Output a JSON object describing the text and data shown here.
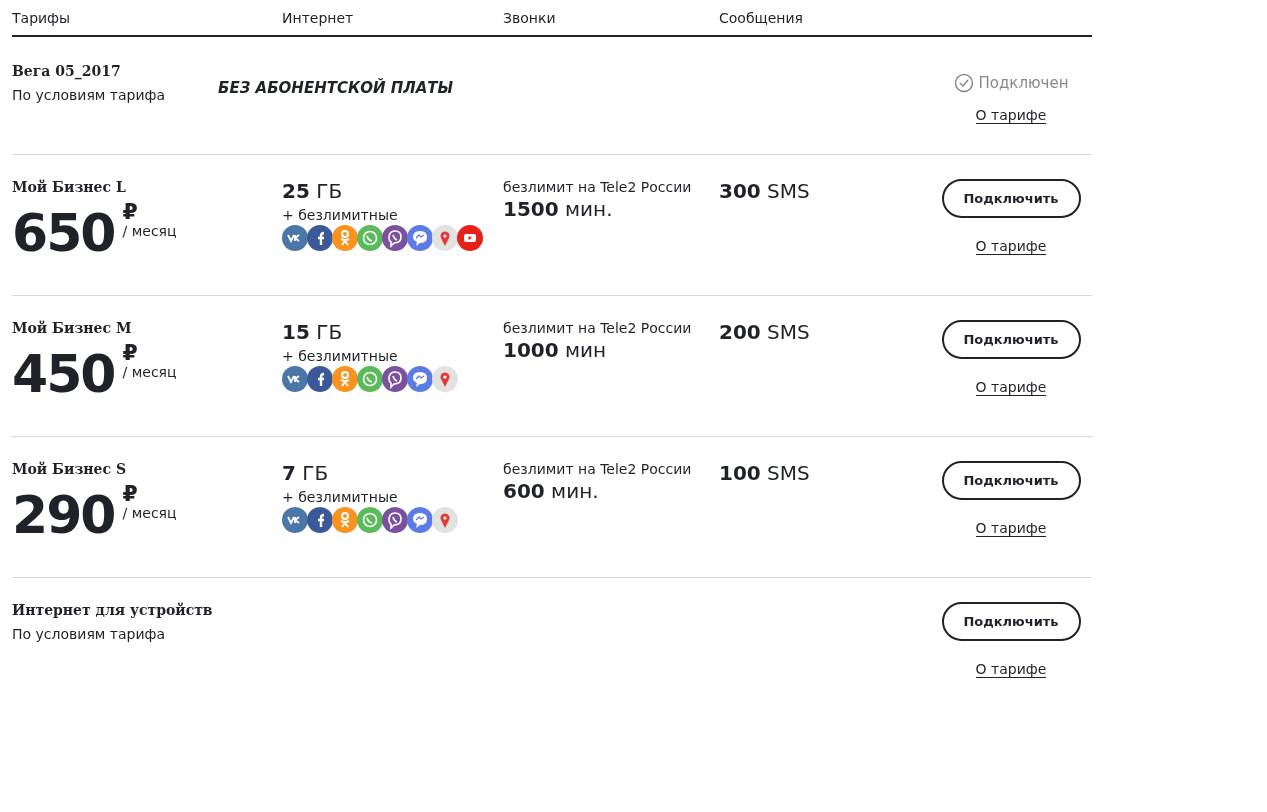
{
  "header": {
    "columns": [
      "Тарифы",
      "Интернет",
      "Звонки",
      "Сообщения"
    ]
  },
  "tariffs": [
    {
      "kind": "special",
      "name": "Вега 05_2017",
      "subtitle": "По условиям тарифа",
      "note": "БЕЗ АБОНЕНТСКОЙ ПЛАТЫ",
      "connected": true,
      "status": "Подключен",
      "link": "О тарифе"
    },
    {
      "kind": "plan",
      "name": "Мой Бизнес L",
      "price": "650",
      "currency": "₽",
      "period": "/ месяц",
      "data_amount": "25",
      "data_unit": "ГБ",
      "unlimited_label": "+ безлимитные",
      "apps": [
        {
          "kind": "vk",
          "color": "#4a76a8"
        },
        {
          "kind": "facebook",
          "color": "#3b5998"
        },
        {
          "kind": "ok",
          "color": "#f7931e"
        },
        {
          "kind": "whatsapp",
          "color": "#5bba5b"
        },
        {
          "kind": "viber",
          "color": "#7b519d"
        },
        {
          "kind": "messenger",
          "color": "#5b7be6"
        },
        {
          "kind": "maps",
          "color": "#e2e2e2"
        },
        {
          "kind": "youtube",
          "color": "#e62117"
        }
      ],
      "calls_label": "безлимит на Tele2 России",
      "minutes_amount": "1500",
      "minutes_unit": "мин.",
      "sms_amount": "300",
      "sms_unit": "SMS",
      "connected": false,
      "button": "Подключить",
      "link": "О тарифе"
    },
    {
      "kind": "plan",
      "name": "Мой Бизнес M",
      "price": "450",
      "currency": "₽",
      "period": "/ месяц",
      "data_amount": "15",
      "data_unit": "ГБ",
      "unlimited_label": "+ безлимитные",
      "apps": [
        {
          "kind": "vk",
          "color": "#4a76a8"
        },
        {
          "kind": "facebook",
          "color": "#3b5998"
        },
        {
          "kind": "ok",
          "color": "#f7931e"
        },
        {
          "kind": "whatsapp",
          "color": "#5bba5b"
        },
        {
          "kind": "viber",
          "color": "#7b519d"
        },
        {
          "kind": "messenger",
          "color": "#5b7be6"
        },
        {
          "kind": "maps",
          "color": "#e2e2e2"
        }
      ],
      "calls_label": "безлимит на Tele2 России",
      "minutes_amount": "1000",
      "minutes_unit": "мин",
      "sms_amount": "200",
      "sms_unit": "SMS",
      "connected": false,
      "button": "Подключить",
      "link": "О тарифе"
    },
    {
      "kind": "plan",
      "name": "Мой Бизнес S",
      "price": "290",
      "currency": "₽",
      "period": "/ месяц",
      "data_amount": "7",
      "data_unit": "ГБ",
      "unlimited_label": "+ безлимитные",
      "apps": [
        {
          "kind": "vk",
          "color": "#4a76a8"
        },
        {
          "kind": "facebook",
          "color": "#3b5998"
        },
        {
          "kind": "ok",
          "color": "#f7931e"
        },
        {
          "kind": "whatsapp",
          "color": "#5bba5b"
        },
        {
          "kind": "viber",
          "color": "#7b519d"
        },
        {
          "kind": "messenger",
          "color": "#5b7be6"
        },
        {
          "kind": "maps",
          "color": "#e2e2e2"
        }
      ],
      "calls_label": "безлимит на Tele2 России",
      "minutes_amount": "600",
      "minutes_unit": "мин.",
      "sms_amount": "100",
      "sms_unit": "SMS",
      "connected": false,
      "button": "Подключить",
      "link": "О тарифе"
    },
    {
      "kind": "plain",
      "name": "Интернет для устройств",
      "subtitle": "По условиям тарифа",
      "connected": false,
      "button": "Подключить",
      "link": "О тарифе"
    }
  ]
}
